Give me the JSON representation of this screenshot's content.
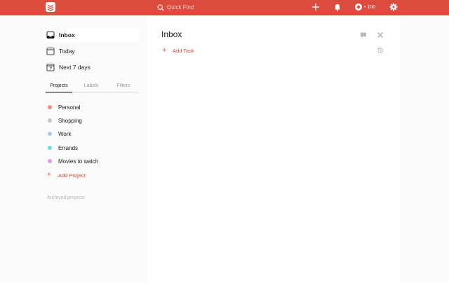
{
  "topbar": {
    "color": "#db4c3f",
    "logo_icon": "todoist-logo",
    "search_placeholder": "Quick Find",
    "karma": "• 100"
  },
  "sidebar": {
    "nav": [
      {
        "label": "Inbox",
        "icon": "inbox-icon"
      },
      {
        "label": "Today",
        "icon": "calendar-icon"
      },
      {
        "label": "Next 7 days",
        "icon": "calendar-week-icon"
      }
    ],
    "tabs": [
      "Projects",
      "Labels",
      "Filters"
    ],
    "active_tab": "Projects",
    "projects": [
      {
        "label": "Personal",
        "color": "#f28b82"
      },
      {
        "label": "Shopping",
        "color": "#c7c7c7"
      },
      {
        "label": "Work",
        "color": "#a8c8e8"
      },
      {
        "label": "Errands",
        "color": "#6fe0d8"
      },
      {
        "label": "Movies to watch",
        "color": "#e39be6"
      }
    ],
    "add_project": "Add Project",
    "archived": "Archived projects"
  },
  "main": {
    "title": "Inbox",
    "add_task": "Add Task"
  }
}
